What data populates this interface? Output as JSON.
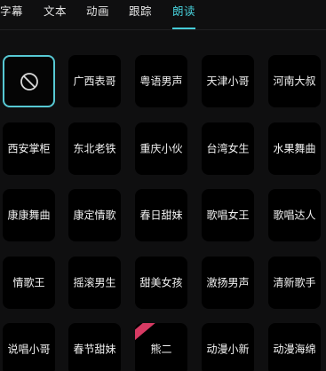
{
  "tabs": [
    {
      "label": "字幕",
      "active": false
    },
    {
      "label": "文本",
      "active": false
    },
    {
      "label": "动画",
      "active": false
    },
    {
      "label": "跟踪",
      "active": false
    },
    {
      "label": "朗读",
      "active": true
    }
  ],
  "accent_color": "#46cdd8",
  "voices": {
    "none_icon": "none-icon",
    "items": [
      {
        "label": "",
        "icon": "none-icon",
        "selected": true
      },
      {
        "label": "广西表哥"
      },
      {
        "label": "粤语男声"
      },
      {
        "label": "天津小哥"
      },
      {
        "label": "河南大叔"
      },
      {
        "label": "西安掌柜"
      },
      {
        "label": "东北老铁"
      },
      {
        "label": "重庆小伙"
      },
      {
        "label": "台湾女生"
      },
      {
        "label": "水果舞曲"
      },
      {
        "label": "康康舞曲"
      },
      {
        "label": "康定情歌"
      },
      {
        "label": "春日甜妹"
      },
      {
        "label": "歌唱女王"
      },
      {
        "label": "歌唱达人"
      },
      {
        "label": "情歌王"
      },
      {
        "label": "摇滚男生"
      },
      {
        "label": "甜美女孩"
      },
      {
        "label": "激扬男声"
      },
      {
        "label": "清新歌手"
      },
      {
        "label": "说唱小哥"
      },
      {
        "label": "春节甜妹"
      },
      {
        "label": "熊二",
        "badge": true
      },
      {
        "label": "动漫小新"
      },
      {
        "label": "动漫海绵"
      }
    ]
  }
}
